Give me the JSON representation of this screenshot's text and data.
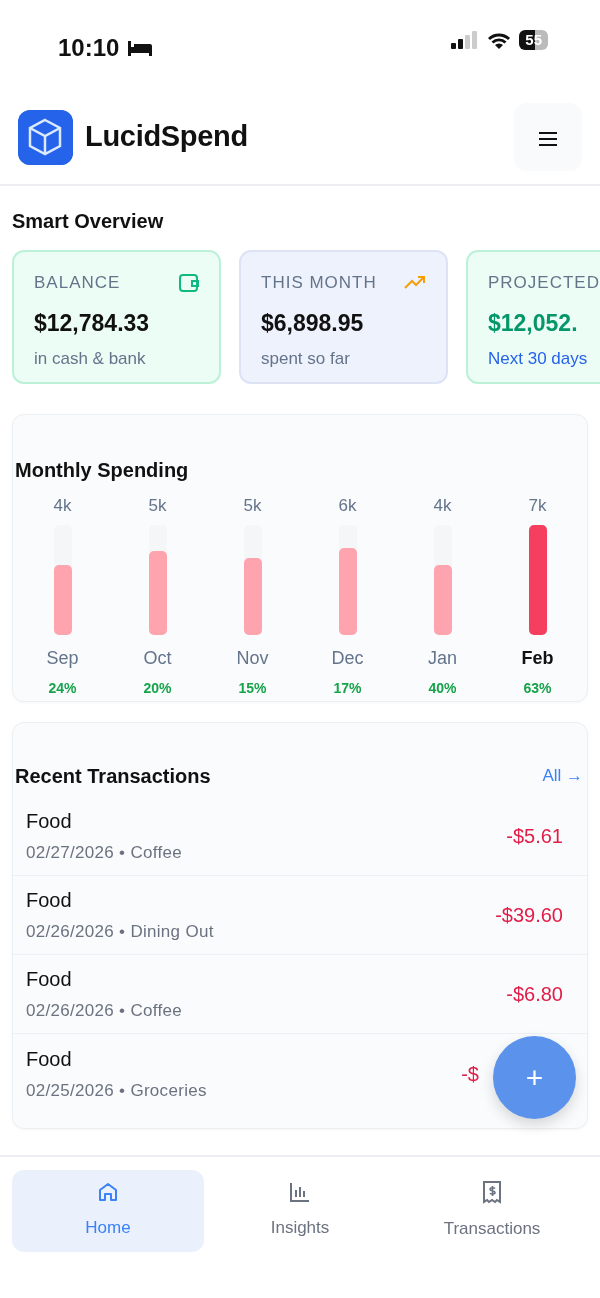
{
  "status_bar": {
    "time": "10:10",
    "battery": "55"
  },
  "app": {
    "name": "LucidSpend"
  },
  "overview": {
    "title": "Smart Overview",
    "cards": [
      {
        "kind": "balance",
        "label": "BALANCE",
        "amount": "$12,784.33",
        "note": "in cash & bank"
      },
      {
        "kind": "month",
        "label": "THIS MONTH",
        "amount": "$6,898.95",
        "note": "spent so far"
      },
      {
        "kind": "projected",
        "label": "PROJECTED",
        "amount": "$12,052.",
        "note": "Next 30 days"
      }
    ]
  },
  "monthly_spending": {
    "title": "Monthly Spending",
    "months": [
      {
        "amount": "4k",
        "month": "Sep",
        "percent": "24%",
        "level": 0.63,
        "selected": false
      },
      {
        "amount": "5k",
        "month": "Oct",
        "percent": "20%",
        "level": 0.76,
        "selected": false
      },
      {
        "amount": "5k",
        "month": "Nov",
        "percent": "15%",
        "level": 0.7,
        "selected": false
      },
      {
        "amount": "6k",
        "month": "Dec",
        "percent": "17%",
        "level": 0.79,
        "selected": false
      },
      {
        "amount": "4k",
        "month": "Jan",
        "percent": "40%",
        "level": 0.63,
        "selected": false
      },
      {
        "amount": "7k",
        "month": "Feb",
        "percent": "63%",
        "level": 1.0,
        "selected": true
      }
    ]
  },
  "recent_transactions": {
    "title": "Recent Transactions",
    "link": "All →",
    "items": [
      {
        "category": "Food",
        "meta": "02/27/2026 • Coffee",
        "amount": "-$5.61"
      },
      {
        "category": "Food",
        "meta": "02/26/2026 • Dining Out",
        "amount": "-$39.60"
      },
      {
        "category": "Food",
        "meta": "02/26/2026 • Coffee",
        "amount": "-$6.80"
      },
      {
        "category": "Food",
        "meta": "02/25/2026 • Groceries",
        "amount": "-$"
      }
    ]
  },
  "fab": {
    "label": "+"
  },
  "bottom_nav": [
    {
      "kind": "home",
      "label": "Home",
      "selected": true
    },
    {
      "kind": "insights",
      "label": "Insights",
      "selected": false
    },
    {
      "kind": "transactions",
      "label": "Transactions",
      "selected": false
    }
  ]
}
